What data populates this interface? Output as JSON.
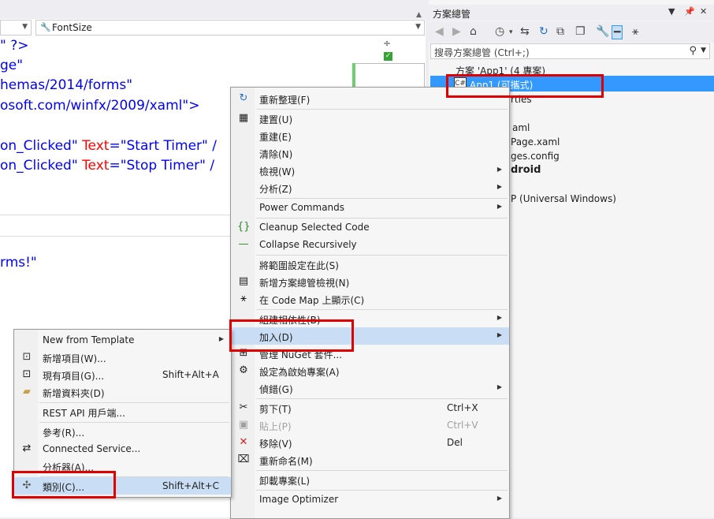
{
  "editor": {
    "nav_member": "FontSize",
    "code_lines": [
      {
        "parts": [
          {
            "t": "\" ?>",
            "c": "blue"
          }
        ]
      },
      {
        "parts": [
          {
            "t": "ge\"",
            "c": "blue"
          }
        ]
      },
      {
        "parts": [
          {
            "t": "hemas/2014/forms\"",
            "c": "blue"
          }
        ]
      },
      {
        "parts": [
          {
            "t": "osoft.com/winfx/2009/xaml\">",
            "c": "blue"
          }
        ]
      },
      {
        "parts": [
          {
            "t": "",
            "c": "blue"
          }
        ]
      },
      {
        "parts": [
          {
            "t": "on_Clicked\" ",
            "c": "blue"
          },
          {
            "t": "Text",
            "c": "red"
          },
          {
            "t": "=\"Start Timer\" /",
            "c": "blue"
          }
        ]
      },
      {
        "parts": [
          {
            "t": "on_Clicked\" ",
            "c": "blue"
          },
          {
            "t": "Text",
            "c": "red"
          },
          {
            "t": "=\"Stop Timer\" /",
            "c": "blue"
          }
        ]
      }
    ],
    "lower_text": "rms!\""
  },
  "solution_explorer": {
    "title": "方案總管",
    "search_placeholder": "搜尋方案總管 (Ctrl+;)",
    "tree": [
      "方案 'App1' (4 專案)",
      "App1 (可攜式)",
      "rties",
      "aml",
      "Page.xaml",
      "ges.config",
      "droid",
      "P (Universal Windows)"
    ]
  },
  "main_menu": [
    {
      "type": "item",
      "label": "重新整理(F)",
      "icon": "refresh-icon",
      "glyph": "↻"
    },
    {
      "type": "sep"
    },
    {
      "type": "item",
      "label": "建置(U)",
      "icon": "build-icon",
      "glyph": "▦"
    },
    {
      "type": "item",
      "label": "重建(E)"
    },
    {
      "type": "item",
      "label": "清除(N)"
    },
    {
      "type": "item",
      "label": "檢視(W)",
      "submenu": true
    },
    {
      "type": "item",
      "label": "分析(Z)",
      "submenu": true
    },
    {
      "type": "sep"
    },
    {
      "type": "item",
      "label": "Power Commands",
      "submenu": true
    },
    {
      "type": "sep"
    },
    {
      "type": "item",
      "label": "Cleanup Selected Code",
      "icon": "braces-icon",
      "glyph": "{}"
    },
    {
      "type": "item",
      "label": "Collapse Recursively",
      "icon": "collapse-icon",
      "glyph": "—"
    },
    {
      "type": "sep"
    },
    {
      "type": "item",
      "label": "將範圍設定在此(S)"
    },
    {
      "type": "item",
      "label": "新增方案總管檢視(N)",
      "icon": "new-view-icon",
      "glyph": "▤"
    },
    {
      "type": "item",
      "label": "在 Code Map 上顯示(C)",
      "icon": "code-map-icon",
      "glyph": "⚹"
    },
    {
      "type": "sep"
    },
    {
      "type": "item",
      "label": "組建相依性(B)",
      "submenu": true
    },
    {
      "type": "item",
      "label": "加入(D)",
      "submenu": true,
      "highlight": true
    },
    {
      "type": "item",
      "label": "管理 NuGet 套件...",
      "icon": "nuget-icon",
      "glyph": "⊞"
    },
    {
      "type": "item",
      "label": "設定為啟始專案(A)",
      "icon": "gear-icon",
      "glyph": "⚙"
    },
    {
      "type": "item",
      "label": "偵錯(G)",
      "submenu": true
    },
    {
      "type": "sep"
    },
    {
      "type": "item",
      "label": "剪下(T)",
      "shortcut": "Ctrl+X",
      "icon": "cut-icon",
      "glyph": "✂"
    },
    {
      "type": "item",
      "label": "貼上(P)",
      "shortcut": "Ctrl+V",
      "icon": "paste-icon",
      "glyph": "▣",
      "disabled": true
    },
    {
      "type": "item",
      "label": "移除(V)",
      "shortcut": "Del",
      "icon": "delete-icon",
      "glyph": "✕"
    },
    {
      "type": "item",
      "label": "重新命名(M)",
      "icon": "rename-icon",
      "glyph": "⌧"
    },
    {
      "type": "sep"
    },
    {
      "type": "item",
      "label": "卸載專案(L)"
    },
    {
      "type": "sep"
    },
    {
      "type": "item",
      "label": "Image Optimizer",
      "submenu": true
    }
  ],
  "add_menu": [
    {
      "type": "item",
      "label": "New from Template",
      "submenu": true
    },
    {
      "type": "item",
      "label": "新增項目(W)...",
      "icon": "new-item-icon",
      "glyph": "⊡"
    },
    {
      "type": "item",
      "label": "現有項目(G)...",
      "shortcut": "Shift+Alt+A",
      "icon": "existing-item-icon",
      "glyph": "⊡"
    },
    {
      "type": "item",
      "label": "新增資料夾(D)",
      "icon": "folder-icon",
      "glyph": "▰"
    },
    {
      "type": "sep"
    },
    {
      "type": "item",
      "label": "REST API 用戶端..."
    },
    {
      "type": "sep"
    },
    {
      "type": "item",
      "label": "參考(R)..."
    },
    {
      "type": "item",
      "label": "Connected Service...",
      "icon": "connected-service-icon",
      "glyph": "⇄"
    },
    {
      "type": "item",
      "label": "分析器(A)..."
    },
    {
      "type": "sep"
    },
    {
      "type": "item",
      "label": "類別(C)...",
      "shortcut": "Shift+Alt+C",
      "icon": "class-icon",
      "glyph": "✣",
      "highlight": true
    }
  ],
  "colors": {
    "accent": "#3399ff",
    "highlight": "#c9def5",
    "annotation": "#e00000"
  }
}
